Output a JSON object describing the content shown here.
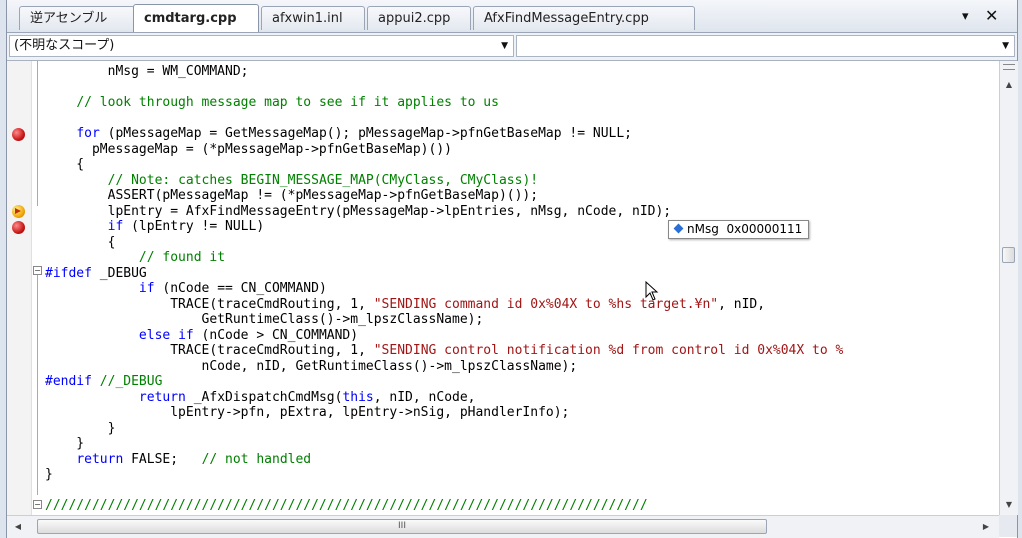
{
  "tabs": [
    {
      "label": "逆アセンブル",
      "active": false
    },
    {
      "label": "cmdtarg.cpp",
      "active": true
    },
    {
      "label": "afxwin1.inl",
      "active": false
    },
    {
      "label": "appui2.cpp",
      "active": false
    },
    {
      "label": "AfxFindMessageEntry.cpp",
      "active": false
    }
  ],
  "tab_controls": {
    "dropdown_icon": "▾",
    "close_icon": "✕"
  },
  "scope": {
    "left_value": "(不明なスコープ)",
    "right_value": ""
  },
  "code_lines": [
    "        nMsg = WM_COMMAND;",
    "",
    "    // look through message map to see if it applies to us",
    "",
    "    for (pMessageMap = GetMessageMap(); pMessageMap->pfnGetBaseMap != NULL;",
    "      pMessageMap = (*pMessageMap->pfnGetBaseMap)())",
    "    {",
    "        // Note: catches BEGIN_MESSAGE_MAP(CMyClass, CMyClass)!",
    "        ASSERT(pMessageMap != (*pMessageMap->pfnGetBaseMap)());",
    "        lpEntry = AfxFindMessageEntry(pMessageMap->lpEntries, nMsg, nCode, nID);",
    "        if (lpEntry != NULL)",
    "        {",
    "            // found it",
    "#ifdef _DEBUG",
    "            if (nCode == CN_COMMAND)",
    "                TRACE(traceCmdRouting, 1, \"SENDING command id 0x%04X to %hs target.¥n\", nID,",
    "                    GetRuntimeClass()->m_lpszClassName);",
    "            else if (nCode > CN_COMMAND)",
    "                TRACE(traceCmdRouting, 1, \"SENDING control notification %d from control id 0x%04X to %",
    "                    nCode, nID, GetRuntimeClass()->m_lpszClassName);",
    "#endif //_DEBUG",
    "            return _AfxDispatchCmdMsg(this, nID, nCode,",
    "                lpEntry->pfn, pExtra, lpEntry->nSig, pHandlerInfo);",
    "        }",
    "    }",
    "    return FALSE;   // not handled",
    "}",
    "",
    "/////////////////////////////////////////////////////////////////////////////"
  ],
  "breakpoint_lines": [
    4,
    10
  ],
  "current_line": 9,
  "tooltip": {
    "name": "nMsg",
    "value": "0x00000111"
  },
  "hscroll_grip": "III"
}
